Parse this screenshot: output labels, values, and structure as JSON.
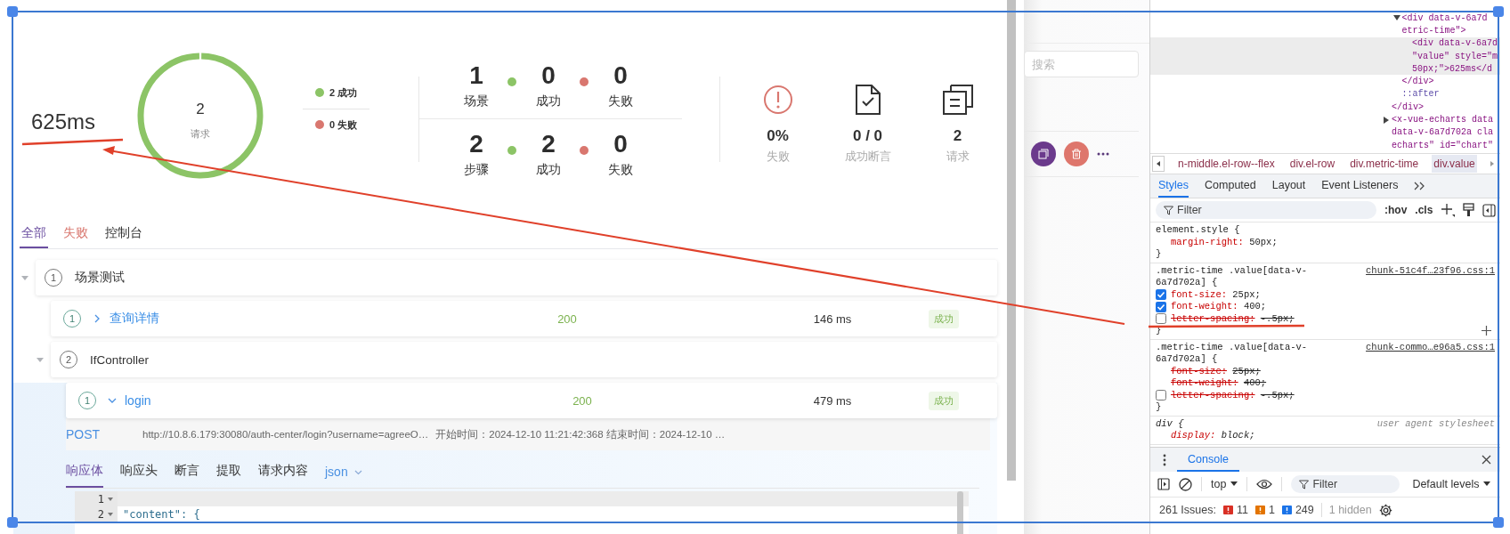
{
  "report": {
    "metric_time": "625ms",
    "donut": {
      "value": "2",
      "label": "请求"
    },
    "legend": [
      {
        "label": "2 成功",
        "color": "#8cc466"
      },
      {
        "label": "0 失败",
        "color": "#d9776f"
      }
    ],
    "counts": [
      {
        "total": "1",
        "total_label": "场景",
        "success": "0",
        "success_label": "成功",
        "fail": "0",
        "fail_label": "失败"
      },
      {
        "total": "2",
        "total_label": "步骤",
        "success": "2",
        "success_label": "成功",
        "fail": "0",
        "fail_label": "失败"
      }
    ],
    "summary": [
      {
        "kind": "alert",
        "value": "0%",
        "label": "失败"
      },
      {
        "kind": "document-check",
        "value": "0 / 0",
        "label": "成功断言"
      },
      {
        "kind": "copies",
        "value": "2",
        "label": "请求"
      }
    ]
  },
  "result_tabs": [
    {
      "label": "全部",
      "kind": "all",
      "selected": true
    },
    {
      "label": "失败",
      "kind": "fail",
      "selected": false
    },
    {
      "label": "控制台",
      "kind": "console",
      "selected": false
    }
  ],
  "tree": [
    {
      "kind": "group",
      "index": "1",
      "name": "场景测试",
      "expanded": true,
      "selected": false,
      "children": [
        {
          "kind": "request",
          "index": "1",
          "name": "查询详情",
          "expanded": false,
          "selected": false,
          "status": "200",
          "time": "146 ms",
          "result": "成功"
        },
        {
          "kind": "group",
          "index": "2",
          "name": "IfController",
          "expanded": true,
          "selected": false,
          "children": [
            {
              "kind": "request",
              "index": "1",
              "name": "login",
              "expanded": true,
              "selected": true,
              "status": "200",
              "time": "479 ms",
              "result": "成功",
              "detail": {
                "method": "POST",
                "url": "http://10.8.6.179:30080/auth-center/login?username=agreeO…",
                "timing": "开始时间：2024-12-10 11:21:42:368 结束时间：2024-12-10 …",
                "tabs": [
                  {
                    "label": "响应体",
                    "selected": true
                  },
                  {
                    "label": "响应头",
                    "selected": false
                  },
                  {
                    "label": "断言",
                    "selected": false
                  },
                  {
                    "label": "提取",
                    "selected": false
                  },
                  {
                    "label": "请求内容",
                    "selected": false
                  }
                ],
                "format": "json",
                "code": [
                  {
                    "number": "1",
                    "active": true
                  },
                  {
                    "number": "2",
                    "text": "\"content\": {",
                    "active": false
                  }
                ]
              }
            }
          ]
        }
      ]
    }
  ],
  "background_page": {
    "search": {
      "placeholder": "搜索"
    }
  },
  "devtools": {
    "dom": [
      {
        "kind": "element",
        "children": [
          {
            "kind": "element",
            "expanded": true,
            "selected": false,
            "lines": [
              "<div data-v-6a7d",
              "etric-time\">"
            ],
            "children": [
              {
                "kind": "element",
                "selected": true,
                "lines": [
                  "<div data-v-6a7d",
                  "\"value\" style=\"m",
                  "50px;\">625ms</d"
                ]
              }
            ],
            "closing": "</div>"
          },
          {
            "kind": "pseudo",
            "selected": false,
            "lines": [
              "::after"
            ]
          }
        ],
        "closing": "</div>"
      },
      {
        "kind": "element",
        "expanded": false,
        "selected": false,
        "lines": [
          "<x-vue-echarts data",
          "data-v-6a7d702a cla",
          "echarts\" id=\"chart\""
        ]
      }
    ],
    "breadcrumbs": [
      {
        "label": "n-middle.el-row--flex",
        "selected": false
      },
      {
        "label": "div.el-row",
        "selected": false
      },
      {
        "label": "div.metric-time",
        "selected": false
      },
      {
        "label": "div.value",
        "selected": true
      }
    ],
    "tabs": [
      {
        "label": "Styles",
        "selected": true
      },
      {
        "label": "Computed",
        "selected": false
      },
      {
        "label": "Layout",
        "selected": false
      },
      {
        "label": "Event Listeners",
        "selected": false
      }
    ],
    "filter": {
      "placeholder": "Filter"
    },
    "toolbar": [
      ":hov",
      ".cls"
    ],
    "rules": [
      {
        "kind": "inline",
        "selector": "element.style {",
        "hovered": false,
        "declarations": [
          {
            "kind": "plain",
            "property": "margin-right:",
            "value": "50px;",
            "struck": false
          }
        ],
        "close": "}"
      },
      {
        "kind": "author",
        "selector": ".metric-time .value[data-v-6a7d702a] {",
        "source": "chunk-51c4f…23f96.css:1",
        "hovered": true,
        "declarations": [
          {
            "kind": "checked",
            "property": "font-size:",
            "value": "25px;",
            "struck": false
          },
          {
            "kind": "checked",
            "property": "font-weight:",
            "value": "400;",
            "struck": false
          },
          {
            "kind": "unchecked",
            "property": "letter-spacing:",
            "value": "-.5px;",
            "struck": true
          }
        ],
        "close": "}"
      },
      {
        "kind": "author",
        "selector": ".metric-time .value[data-v-6a7d702a] {",
        "source": "chunk-commo…e96a5.css:1",
        "hovered": false,
        "declarations": [
          {
            "kind": "plain",
            "property": "font-size:",
            "value": "25px;",
            "struck": true
          },
          {
            "kind": "plain",
            "property": "font-weight:",
            "value": "400;",
            "struck": true
          },
          {
            "kind": "unchecked",
            "property": "letter-spacing:",
            "value": "-.5px;",
            "struck": true
          }
        ],
        "close": "}"
      },
      {
        "kind": "user-agent",
        "selector": "div {",
        "source": "user agent stylesheet",
        "declarations": [
          {
            "kind": "plain",
            "property": "display:",
            "value": "block;",
            "struck": false
          }
        ]
      }
    ],
    "console": {
      "tab": "Console",
      "context": "top",
      "filter": {
        "placeholder": "Filter"
      },
      "levels": "Default levels",
      "issues": {
        "label": "261 Issues:",
        "counts": [
          {
            "kind": "error",
            "count": "11"
          },
          {
            "kind": "warning",
            "count": "1"
          },
          {
            "kind": "info",
            "count": "249"
          }
        ],
        "hidden": "1 hidden"
      }
    }
  }
}
